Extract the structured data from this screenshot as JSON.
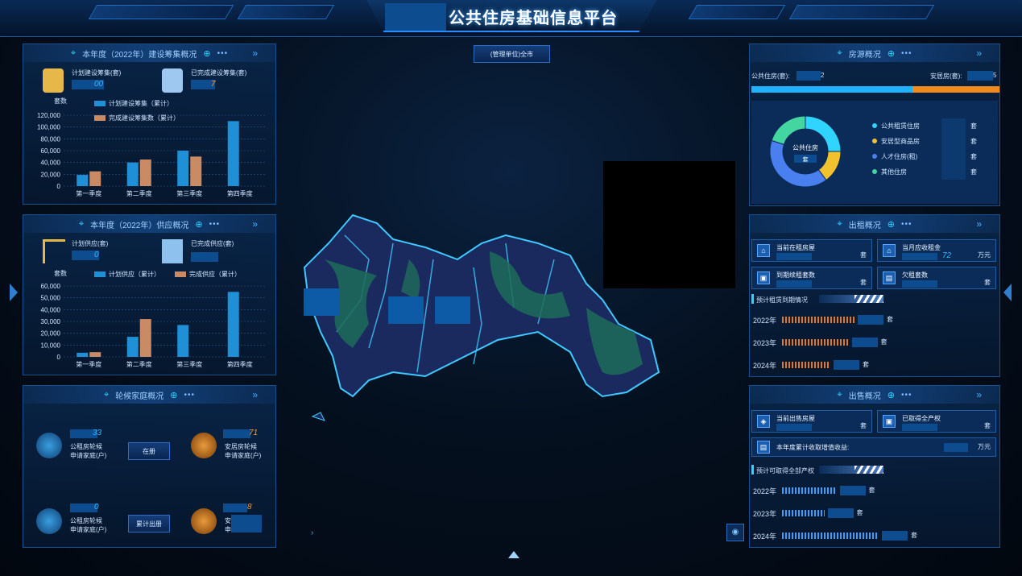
{
  "header": {
    "title": "公共住房基础信息平台"
  },
  "scope_button": "(管理单位)全市",
  "construction": {
    "title": "本年度（2022年）建设筹集概况",
    "plan_label": "计划建设筹集(套)",
    "plan_value_partial": "00",
    "done_label": "已完成建设筹集(套)",
    "done_value_partial": "7",
    "y_unit": "套数",
    "legend": [
      "计划建设筹集（累计）",
      "完成建设筹集数（累计）"
    ],
    "colors": {
      "plan": "#1f8fd6",
      "done": "#c98a64"
    }
  },
  "chart_data": [
    {
      "type": "bar",
      "title": "本年度（2022年）建设筹集概况",
      "ylabel": "套数",
      "categories": [
        "第一季度",
        "第二季度",
        "第三季度",
        "第四季度"
      ],
      "ylim": [
        0,
        120000
      ],
      "yticks": [
        "0",
        "20,000",
        "40,000",
        "60,000",
        "80,000",
        "100,000",
        "120,000"
      ],
      "series": [
        {
          "name": "计划建设筹集（累计）",
          "values": [
            19000,
            40000,
            60000,
            110000
          ]
        },
        {
          "name": "完成建设筹集数（累计）",
          "values": [
            25000,
            45000,
            50000,
            null
          ]
        }
      ]
    },
    {
      "type": "bar",
      "title": "本年度（2022年）供应概况",
      "ylabel": "套数",
      "categories": [
        "第一季度",
        "第二季度",
        "第三季度",
        "第四季度"
      ],
      "ylim": [
        0,
        60000
      ],
      "yticks": [
        "0",
        "10,000",
        "20,000",
        "30,000",
        "40,000",
        "50,000",
        "60,000"
      ],
      "series": [
        {
          "name": "计划供应（累计）",
          "values": [
            3500,
            17000,
            27000,
            55000
          ]
        },
        {
          "name": "完成供应（累计）",
          "values": [
            4000,
            32000,
            null,
            null
          ]
        }
      ]
    },
    {
      "type": "pie",
      "title": "房源概况",
      "center_label": "公共住房",
      "center_unit": "套",
      "categories": [
        "公共租赁住房",
        "安居型商品房",
        "人才住房(租)",
        "其他住房"
      ],
      "values": [
        25,
        15,
        40,
        20
      ],
      "colors": [
        "#2fd4ff",
        "#f2c12e",
        "#4a7ff0",
        "#43d6a0"
      ]
    }
  ],
  "supply": {
    "title": "本年度（2022年）供应概况",
    "plan_label": "计划供应(套)",
    "plan_value_partial": "0",
    "done_label": "已完成供应(套)",
    "y_unit": "套数",
    "legend": [
      "计划供应（累计）",
      "完成供应（累计）"
    ]
  },
  "waitlist": {
    "title": "轮候家庭概况",
    "items": [
      {
        "num": "33",
        "label1": "公租房轮候",
        "label2": "申请家庭(户)"
      },
      {
        "num": "71",
        "label1": "安居房轮候",
        "label2": "申请家庭(户)"
      },
      {
        "num": "0",
        "label1": "公租房轮候",
        "label2": "申请家庭(户)"
      },
      {
        "num": "8",
        "label1": "安",
        "label2": "申"
      }
    ],
    "btn_current": "在册",
    "btn_total": "累计出册"
  },
  "housing": {
    "title": "房源概况",
    "public_label": "公共住房(套):",
    "public_value_partial": "2",
    "anju_label": "安居房(套):",
    "anju_value_partial": "5",
    "unit": "套"
  },
  "rental": {
    "title": "出租概况",
    "current_rent": "当前在租房屋",
    "rent_collected": "当月应收租金",
    "rent_value": "72",
    "rent_unit": "万元",
    "due_soon": "到期续租套数",
    "arrears": "欠租套数",
    "unit": "套",
    "expiry_title": "预计租赁到期情况",
    "years": [
      "2022年",
      "2023年",
      "2024年"
    ],
    "bars": [
      0.6,
      0.55,
      0.4
    ]
  },
  "sales": {
    "title": "出售概况",
    "current_sale": "当前出售房屋",
    "obtained": "已取得全产权",
    "unit": "套",
    "income_label": "本年度累计收取增值收益:",
    "income_unit": "万元",
    "forecast_title": "预计可取得全部产权",
    "years": [
      "2022年",
      "2023年",
      "2024年"
    ],
    "bars": [
      0.45,
      0.35,
      0.8
    ]
  }
}
